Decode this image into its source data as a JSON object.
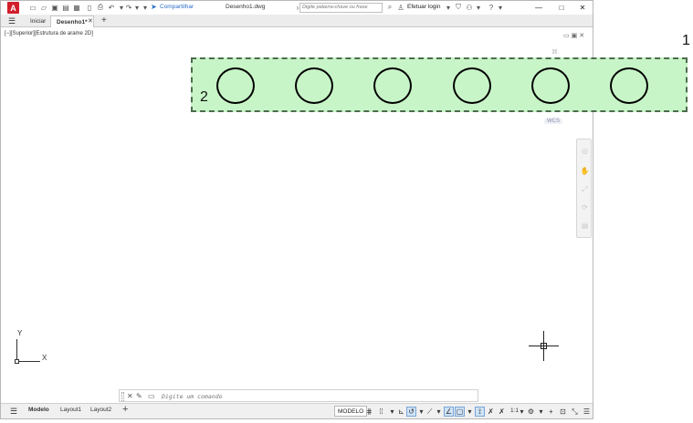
{
  "app": {
    "logo_letter": "A",
    "share_label": "Compartilhar",
    "doc_title": "Desenho1.dwg",
    "search_placeholder": "Digite palavra-chave ou frase",
    "login_label": "Efetuar login"
  },
  "tabs": {
    "start": "Iniciar",
    "drawing": "Desenho1*"
  },
  "viewport": {
    "label": "[−][Superior][Estrutura de arame 2D]",
    "wcs": "WCS"
  },
  "annotations": {
    "callout_1": "1",
    "callout_2": "2",
    "highlight_color": "#c8f5c8",
    "circle_count": 6
  },
  "ucs": {
    "y_label": "Y",
    "x_label": "X"
  },
  "command": {
    "placeholder": "Digite um comando"
  },
  "status": {
    "layout_tabs": [
      "Modelo",
      "Layout1",
      "Layout2"
    ],
    "model_button": "MODELO",
    "scale": "1:1"
  },
  "icons": {
    "menu": "☰",
    "close": "✕",
    "add": "+",
    "minimize": "—",
    "maximize": "□",
    "search": "⌕",
    "help": "?",
    "cart": "⌁",
    "gear": "⚙",
    "pencil": "✎",
    "share": "➤"
  }
}
